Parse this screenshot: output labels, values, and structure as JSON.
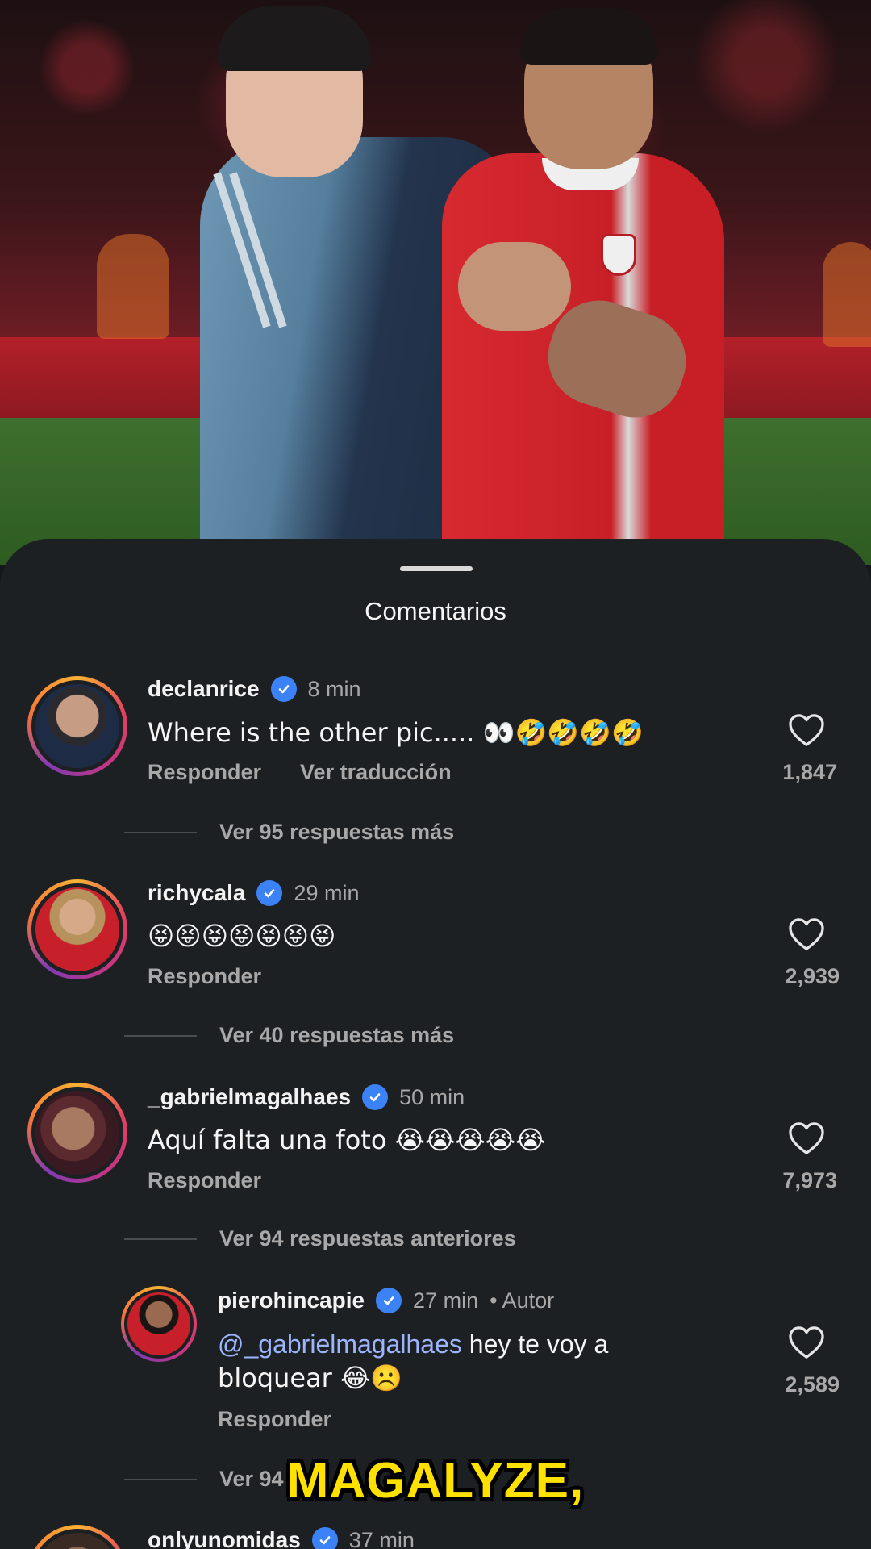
{
  "sheet": {
    "title": "Comentarios"
  },
  "comments": [
    {
      "username": "declanrice",
      "time": "8 min",
      "text": "Where is the other pic..... 👀🤣🤣🤣🤣",
      "reply_label": "Responder",
      "translate_label": "Ver traducción",
      "likes": "1,847",
      "view_replies": "Ver 95 respuestas más"
    },
    {
      "username": "richycala",
      "time": "29 min",
      "text": "😝😝😝😝😝😝😝",
      "reply_label": "Responder",
      "likes": "2,939",
      "view_replies": "Ver 40 respuestas más"
    },
    {
      "username": "_gabrielmagalhaes",
      "time": "50 min",
      "text": "Aquí falta una foto 😭😭😭😭😭",
      "reply_label": "Responder",
      "likes": "7,973",
      "view_replies": "Ver 94 respuestas anteriores"
    },
    {
      "username": "pierohincapie",
      "time": "27 min",
      "author_badge": "• Autor",
      "mention": "@_gabrielmagalhaes",
      "text_line1": " hey te voy a",
      "text_line2": "bloquear 😂☹️",
      "reply_label": "Responder",
      "likes": "2,589",
      "view_replies": "Ver 94"
    },
    {
      "username": "onlyunomidas",
      "time": "37 min"
    }
  ],
  "caption": "MAGALYZE,",
  "colors": {
    "background": "#1d2023",
    "verified": "#3b82f6",
    "mention": "#9db5ff",
    "caption": "#ffe100"
  }
}
